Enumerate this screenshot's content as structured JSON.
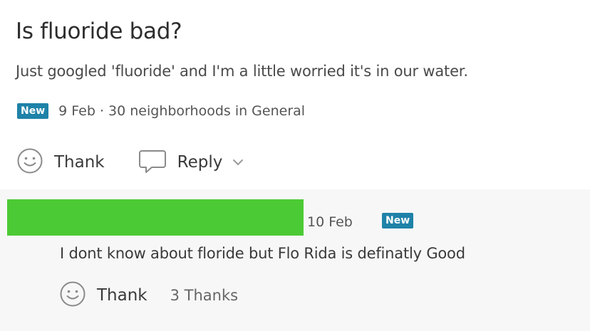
{
  "post": {
    "title": "Is fluoride bad?",
    "body": "Just googled 'fluoride' and I'm a little worried it's in our water.",
    "badge": "New",
    "meta": "9 Feb · 30 neighborhoods in General",
    "actions": {
      "thank_label": "Thank",
      "reply_label": "Reply",
      "thank_icon": "smiley-icon",
      "reply_icon": "speech-bubble-icon",
      "dropdown_icon": "chevron-down-icon"
    }
  },
  "reply": {
    "date": "10 Feb",
    "badge": "New",
    "text": "I dont know about floride but Flo Rida is definatly Good",
    "thank_label": "Thank",
    "thanks_count": "3 Thanks",
    "thank_icon": "smiley-icon"
  },
  "colors": {
    "badge": "#1f82a8",
    "redaction": "#4cca35",
    "reply_background": "#f7f7f7"
  }
}
